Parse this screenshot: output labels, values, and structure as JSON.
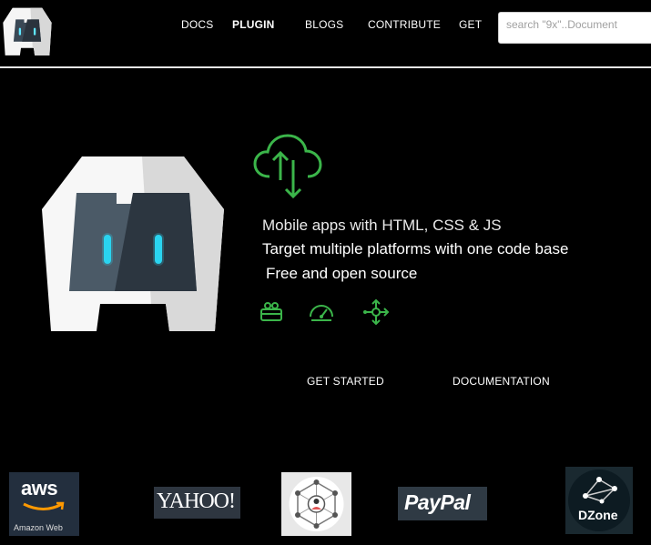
{
  "header": {
    "nav": [
      "DOCS",
      "PLUGIN",
      "BLOGS",
      "CONTRIBUTE",
      "GET"
    ],
    "search_placeholder": "search \"9x\"..Document"
  },
  "hero": {
    "taglines": [
      "Mobile apps with HTML, CSS & JS",
      "Target multiple platforms with one code base",
      "Free and open source"
    ],
    "buttons": {
      "get_started": "GET STARTED",
      "documentation": "DOCUMENTATION"
    },
    "icons": [
      "cloud-upload-download-icon",
      "box-icon",
      "speedometer-icon",
      "network-arrows-icon"
    ]
  },
  "sponsors": {
    "aws": {
      "logo": "aws",
      "caption": "Amazon Web"
    },
    "yahoo": "YAHOO!",
    "paypal": "PayPal",
    "dzone": "DZone"
  },
  "colors": {
    "accent_green": "#3bb54a",
    "logo_blue": "#2ad4f0",
    "background": "#000000"
  }
}
